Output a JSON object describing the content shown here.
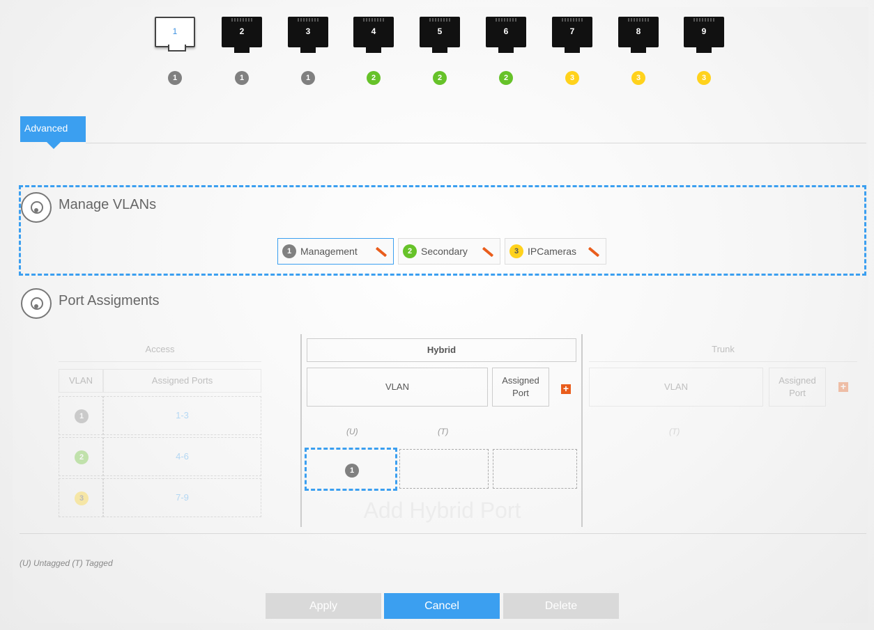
{
  "ports": [
    {
      "label": "1",
      "vlan": "1"
    },
    {
      "label": "2",
      "vlan": "1"
    },
    {
      "label": "3",
      "vlan": "1"
    },
    {
      "label": "4",
      "vlan": "2"
    },
    {
      "label": "5",
      "vlan": "2"
    },
    {
      "label": "6",
      "vlan": "2"
    },
    {
      "label": "7",
      "vlan": "3"
    },
    {
      "label": "8",
      "vlan": "3"
    },
    {
      "label": "9",
      "vlan": "3"
    }
  ],
  "tab": {
    "label": "Advanced"
  },
  "manage": {
    "title": "Manage VLANs",
    "vlans": [
      {
        "id": "1",
        "name": "Management"
      },
      {
        "id": "2",
        "name": "Secondary"
      },
      {
        "id": "3",
        "name": "IPCameras"
      }
    ]
  },
  "assign": {
    "title": "Port Assigments",
    "access": {
      "header": "Access",
      "col_vlan": "VLAN",
      "col_ports": "Assigned Ports",
      "rows": [
        {
          "vlan": "1",
          "ports": "1-3"
        },
        {
          "vlan": "2",
          "ports": "4-6"
        },
        {
          "vlan": "3",
          "ports": "7-9"
        }
      ]
    },
    "hybrid": {
      "header": "Hybrid",
      "col_vlan": "VLAN",
      "col_port": "Assigned Port",
      "u": "(U)",
      "t": "(T)",
      "row_vlan": "1",
      "add_label": "Add Hybrid Port"
    },
    "trunk": {
      "header": "Trunk",
      "col_vlan": "VLAN",
      "col_port": "Assigned Port",
      "t": "(T)"
    }
  },
  "legend": "(U) Untagged (T) Tagged",
  "buttons": {
    "apply": "Apply",
    "cancel": "Cancel",
    "delete": "Delete"
  },
  "colors": {
    "accent": "#3b9ff0",
    "vlan1": "#808080",
    "vlan2": "#66c229",
    "vlan3": "#ffd21c",
    "edit": "#e95d1c"
  }
}
